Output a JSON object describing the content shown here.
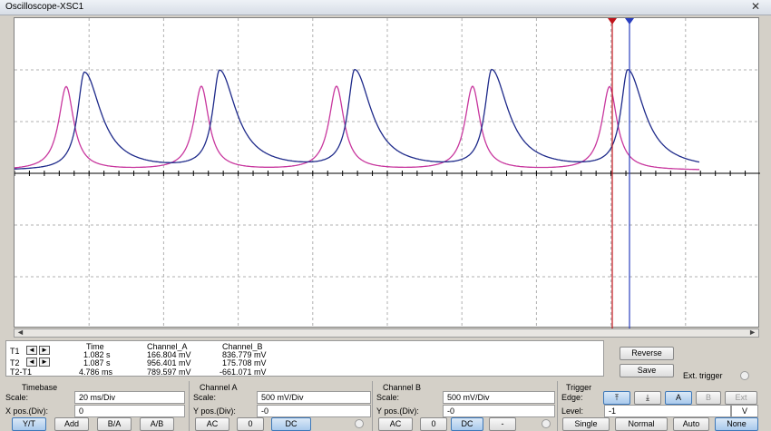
{
  "window": {
    "title": "Oscilloscope-XSC1",
    "close_glyph": "✕"
  },
  "readout": {
    "headers": {
      "time": "Time",
      "channel_a": "Channel_A",
      "channel_b": "Channel_B"
    },
    "rows": [
      {
        "label": "T1",
        "time": "1.082 s",
        "a": "166.804 mV",
        "b": "836.779 mV"
      },
      {
        "label": "T2",
        "time": "1.087 s",
        "a": "956.401 mV",
        "b": "175.708 mV"
      },
      {
        "label": "T2-T1",
        "time": "4.786 ms",
        "a": "789.597 mV",
        "b": "-661.071 mV"
      }
    ]
  },
  "actions": {
    "reverse": "Reverse",
    "save": "Save",
    "ext_trigger": "Ext. trigger"
  },
  "timebase": {
    "title": "Timebase",
    "scale_label": "Scale:",
    "scale": "20 ms/Div",
    "xpos_label": "X pos.(Div):",
    "xpos": "0",
    "buttons": [
      "Y/T",
      "Add",
      "B/A",
      "A/B"
    ]
  },
  "channel_a": {
    "title": "Channel A",
    "scale_label": "Scale:",
    "scale": "500 mV/Div",
    "ypos_label": "Y pos.(Div):",
    "ypos": "-0",
    "buttons": [
      "AC",
      "0",
      "DC"
    ]
  },
  "channel_b": {
    "title": "Channel B",
    "scale_label": "Scale:",
    "scale": "500 mV/Div",
    "ypos_label": "Y pos.(Div):",
    "ypos": "-0",
    "buttons": [
      "AC",
      "0",
      "DC",
      "-"
    ]
  },
  "trigger": {
    "title": "Trigger",
    "edge_label": "Edge:",
    "edge_buttons": [
      "⤒",
      "⤓",
      "A",
      "B",
      "Ext"
    ],
    "level_label": "Level:",
    "level": "-1",
    "level_unit": "V",
    "mode_buttons": [
      "Single",
      "Normal",
      "Auto",
      "None"
    ]
  },
  "colors": {
    "channel_a": "#c8379e",
    "channel_b": "#1e2a8a",
    "cursor_1": "#c0141c",
    "cursor_2": "#2a3fbf",
    "grid": "#b0b0b0"
  },
  "icons": [
    "left-arrow-icon",
    "right-arrow-icon",
    "close-icon",
    "rising-edge-icon",
    "falling-edge-icon"
  ]
}
